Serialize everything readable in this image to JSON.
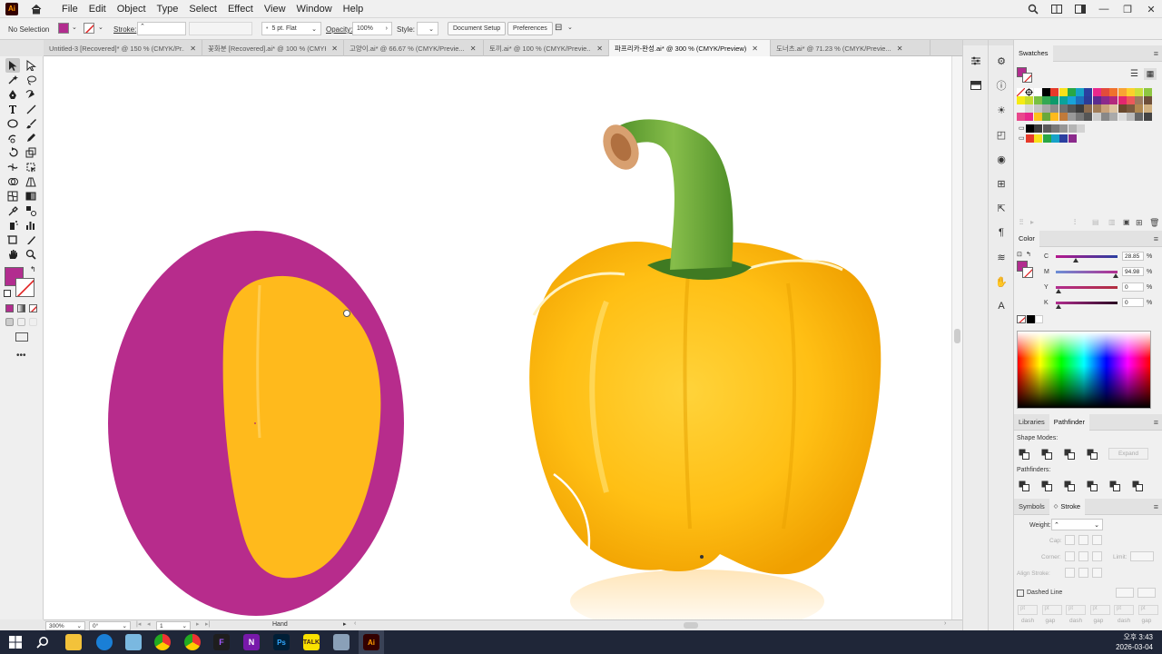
{
  "app": {
    "logo_text": "Ai",
    "menu": [
      "File",
      "Edit",
      "Object",
      "Type",
      "Select",
      "Effect",
      "View",
      "Window",
      "Help"
    ]
  },
  "control_bar": {
    "selection_label": "No Selection",
    "fill_color": "#b22d8f",
    "stroke_label": "Stroke:",
    "brush_value": "5 pt. Flat",
    "opacity_label": "Opacity:",
    "opacity_value": "100%",
    "style_label": "Style:",
    "document_setup": "Document Setup",
    "preferences": "Preferences"
  },
  "tabs": [
    {
      "label": "Untitled-3 [Recovered]* @ 150 % (CMYK/Pr...",
      "active": false
    },
    {
      "label": "꽃화분 [Recovered].ai* @ 100 % (CMYK/Pre...",
      "active": false
    },
    {
      "label": "고양이.ai* @ 66.67 % (CMYK/Previe...",
      "active": false
    },
    {
      "label": "토끼.ai* @ 100 % (CMYK/Previe...",
      "active": false
    },
    {
      "label": "파프리카-완성.ai* @ 300 % (CMYK/Preview)",
      "active": true
    },
    {
      "label": "도너츠.ai* @ 71.23 % (CMYK/Previe...",
      "active": false
    }
  ],
  "tools": [
    "selection-tool",
    "direct-selection-tool",
    "magic-wand-tool",
    "lasso-tool",
    "pen-tool",
    "curvature-tool",
    "type-tool",
    "line-tool",
    "ellipse-tool",
    "paintbrush-tool",
    "shaper-tool",
    "pencil-tool",
    "rotate-tool",
    "scale-tool",
    "width-tool",
    "free-transform-tool",
    "shape-builder-tool",
    "perspective-tool",
    "mesh-tool",
    "gradient-tool",
    "eyedropper-tool",
    "blend-tool",
    "symbol-sprayer-tool",
    "graph-tool",
    "artboard-tool",
    "slice-tool",
    "hand-tool",
    "zoom-tool"
  ],
  "canvas": {
    "ellipse_color": "#b72c8c",
    "inner_color": "#ffba1c",
    "pepper_color": "#ffc21a",
    "stem_color": "#6aa83a"
  },
  "statusbar": {
    "zoom": "300%",
    "rotation": "0°",
    "artboard": "1",
    "tool": "Hand"
  },
  "panels": {
    "swatches": {
      "title": "Swatches"
    },
    "color": {
      "title": "Color",
      "channels": [
        {
          "label": "C",
          "value": "28.85",
          "unit": "%",
          "pct": 0.29
        },
        {
          "label": "M",
          "value": "94.98",
          "unit": "%",
          "pct": 0.95
        },
        {
          "label": "Y",
          "value": "0",
          "unit": "%",
          "pct": 0
        },
        {
          "label": "K",
          "value": "0",
          "unit": "%",
          "pct": 0
        }
      ]
    },
    "pathfinder": {
      "tabs": [
        "Libraries",
        "Pathfinder"
      ],
      "shape_modes_label": "Shape Modes:",
      "pathfinders_label": "Pathfinders:",
      "expand_label": "Expand"
    },
    "stroke": {
      "tabs": [
        "Symbols",
        "Stroke"
      ],
      "weight_label": "Weight:",
      "cap_label": "Cap:",
      "corner_label": "Corner:",
      "limit_label": "Limit:",
      "align_label": "Align Stroke:",
      "dashed_label": "Dashed Line",
      "dash_values": [
        "pt",
        "pt",
        "pt",
        "pt",
        "pt",
        "pt"
      ],
      "dash_labels": [
        "dash",
        "gap",
        "dash",
        "gap",
        "dash",
        "gap"
      ]
    }
  },
  "taskbar": {
    "time": "오후 3:43",
    "date": "2026-03-04"
  }
}
